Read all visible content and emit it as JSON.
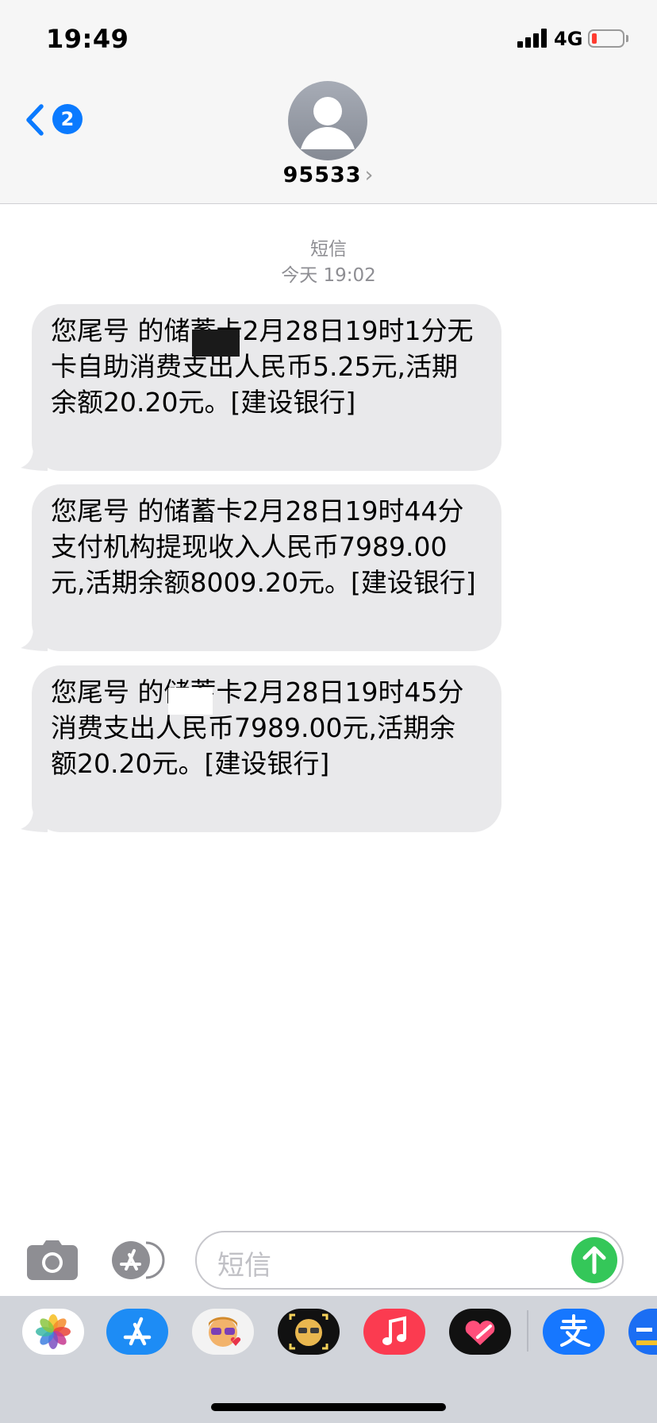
{
  "status_bar": {
    "time": "19:49",
    "network": "4G",
    "battery_level": 0.1,
    "battery_color": "#ff3b30"
  },
  "header": {
    "back_badge_count": "2",
    "contact_name": "95533",
    "contact_chevron": "›",
    "accent_color": "#0a7aff"
  },
  "conversation": {
    "service_label": "短信",
    "timestamp": "今天 19:02",
    "bubble_color": "#e9e9eb",
    "messages": [
      {
        "text": "您尾号 的储蓄卡2月28日19时1分无卡自助消费支出人民币5.25元,活期余额20.20元。[建设银行]"
      },
      {
        "text": "您尾号 的储蓄卡2月28日19时44分支付机构提现收入人民币7989.00元,活期余额8009.20元。[建设银行]"
      },
      {
        "text": "您尾号 的储蓄卡2月28日19时45分消费支出人民币7989.00元,活期余额20.20元。[建设银行]"
      }
    ]
  },
  "input_bar": {
    "placeholder": "短信",
    "send_color": "#34c759"
  },
  "app_drawer": {
    "apps": [
      {
        "name": "photos-icon"
      },
      {
        "name": "app-store-icon"
      },
      {
        "name": "memoji-stickers-icon"
      },
      {
        "name": "animoji-icon"
      },
      {
        "name": "music-icon"
      },
      {
        "name": "digital-touch-icon"
      },
      {
        "name": "alipay-icon"
      },
      {
        "name": "second-hand-app-icon"
      }
    ]
  }
}
